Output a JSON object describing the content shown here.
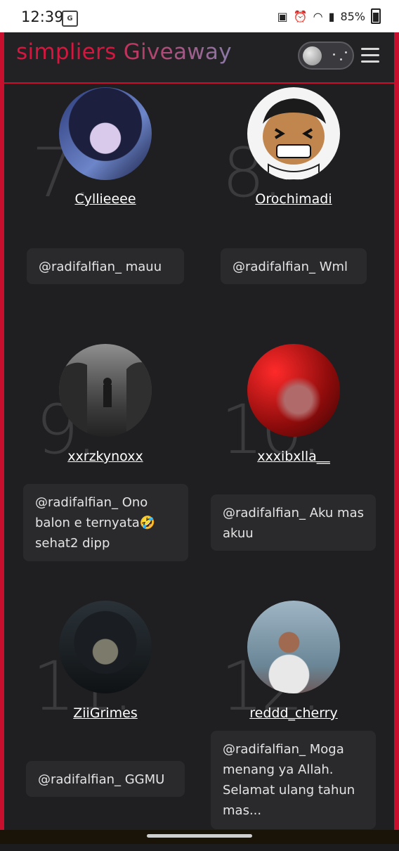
{
  "status_bar": {
    "time": "12:39",
    "battery": "85%",
    "icons": [
      "translate-icon",
      "bug-icon",
      "alarm-icon",
      "wifi-icon",
      "signal-icon",
      "battery-icon"
    ]
  },
  "header": {
    "brand_part1": "simpliers",
    "brand_part2": "Giveaway",
    "accent_color": "#c8102e"
  },
  "entries": [
    {
      "rank": "7.",
      "username": "Cyllieeee",
      "comment": "@radifalfian_ mauu"
    },
    {
      "rank": "8.",
      "username": "Orochimadi",
      "comment": "@radifalfian_ Wml"
    },
    {
      "rank": "9.",
      "username": "xxrzkynoxx",
      "comment": "@radifalfian_ Ono balon e ternyata🤣 sehat2 dipp"
    },
    {
      "rank": "10.",
      "username": "xxxibxlla__",
      "comment": "@radifalfian_ Aku mas akuu"
    },
    {
      "rank": "11.",
      "username": "ZiiGrimes",
      "comment": "@radifalfian_ GGMU"
    },
    {
      "rank": "12.",
      "username": "reddd_cherry",
      "comment": "@radifalfian_ Moga menang ya Allah. Selamat ulang tahun mas..."
    }
  ]
}
